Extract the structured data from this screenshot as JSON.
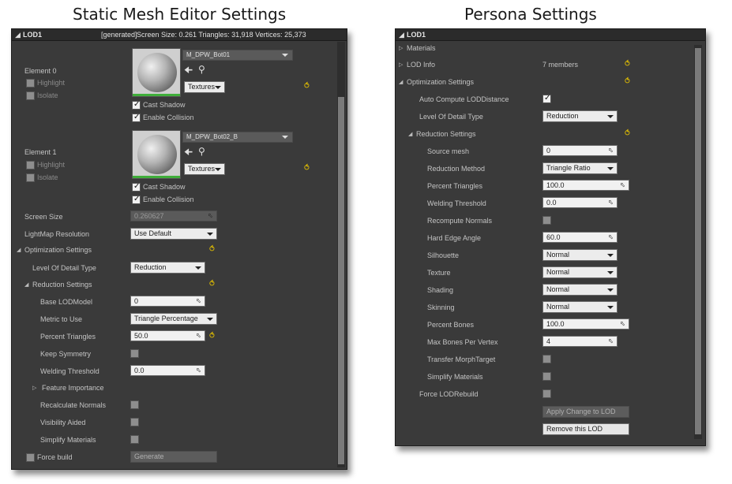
{
  "headings": {
    "left": "Static Mesh Editor Settings",
    "right": "Persona Settings"
  },
  "left": {
    "title": "LOD1",
    "generated": "[generated]",
    "stats": "Screen Size: 0.261   Triangles: 31,918   Vertices: 25,373",
    "elements": [
      {
        "label": "Element 0",
        "material": "M_DPW_Bot01",
        "textures": "Textures",
        "highlight": "Highlight",
        "isolate": "Isolate",
        "cast_shadow": "Cast Shadow",
        "enable_collision": "Enable Collision"
      },
      {
        "label": "Element 1",
        "material": "M_DPW_Bot02_B",
        "textures": "Textures",
        "highlight": "Highlight",
        "isolate": "Isolate",
        "cast_shadow": "Cast Shadow",
        "enable_collision": "Enable Collision"
      }
    ],
    "screen_size": {
      "label": "Screen Size",
      "value": "0.260627"
    },
    "lightmap": {
      "label": "LightMap Resolution",
      "value": "Use Default"
    },
    "optimization": "Optimization Settings",
    "lod_type": {
      "label": "Level Of Detail Type",
      "value": "Reduction"
    },
    "reduction": "Reduction Settings",
    "base_lod": {
      "label": "Base LODModel",
      "value": "0"
    },
    "metric": {
      "label": "Metric to Use",
      "value": "Triangle Percentage"
    },
    "percent_triangles": {
      "label": "Percent Triangles",
      "value": "50.0"
    },
    "keep_symmetry": {
      "label": "Keep Symmetry"
    },
    "welding": {
      "label": "Welding Threshold",
      "value": "0.0"
    },
    "feature_importance": {
      "label": "Feature Importance"
    },
    "recalc_normals": {
      "label": "Recalculate Normals"
    },
    "visibility_aided": {
      "label": "Visibility Aided"
    },
    "simplify_materials": {
      "label": "Simplify Materials"
    },
    "force_build": {
      "label": "Force build",
      "button": "Generate"
    }
  },
  "right": {
    "title": "LOD1",
    "materials": "Materials",
    "lod_info": {
      "label": "LOD Info",
      "value": "7 members"
    },
    "optimization": "Optimization Settings",
    "auto_compute": {
      "label": "Auto Compute LODDistance"
    },
    "lod_type": {
      "label": "Level Of Detail Type",
      "value": "Reduction"
    },
    "reduction": "Reduction Settings",
    "source_mesh": {
      "label": "Source mesh",
      "value": "0"
    },
    "reduction_method": {
      "label": "Reduction Method",
      "value": "Triangle Ratio"
    },
    "percent_triangles": {
      "label": "Percent Triangles",
      "value": "100.0"
    },
    "welding": {
      "label": "Welding Threshold",
      "value": "0.0"
    },
    "recompute_normals": {
      "label": "Recompute Normals"
    },
    "hard_edge": {
      "label": "Hard Edge Angle",
      "value": "60.0"
    },
    "silhouette": {
      "label": "Silhouette",
      "value": "Normal"
    },
    "texture": {
      "label": "Texture",
      "value": "Normal"
    },
    "shading": {
      "label": "Shading",
      "value": "Normal"
    },
    "skinning": {
      "label": "Skinning",
      "value": "Normal"
    },
    "percent_bones": {
      "label": "Percent Bones",
      "value": "100.0"
    },
    "max_bones": {
      "label": "Max Bones Per Vertex",
      "value": "4"
    },
    "transfer_morph": {
      "label": "Transfer MorphTarget"
    },
    "simplify_materials": {
      "label": "Simplify Materials"
    },
    "force_rebuild": {
      "label": "Force LODRebuild"
    },
    "apply_button": "Apply Change to LOD",
    "remove_button": "Remove this LOD"
  }
}
